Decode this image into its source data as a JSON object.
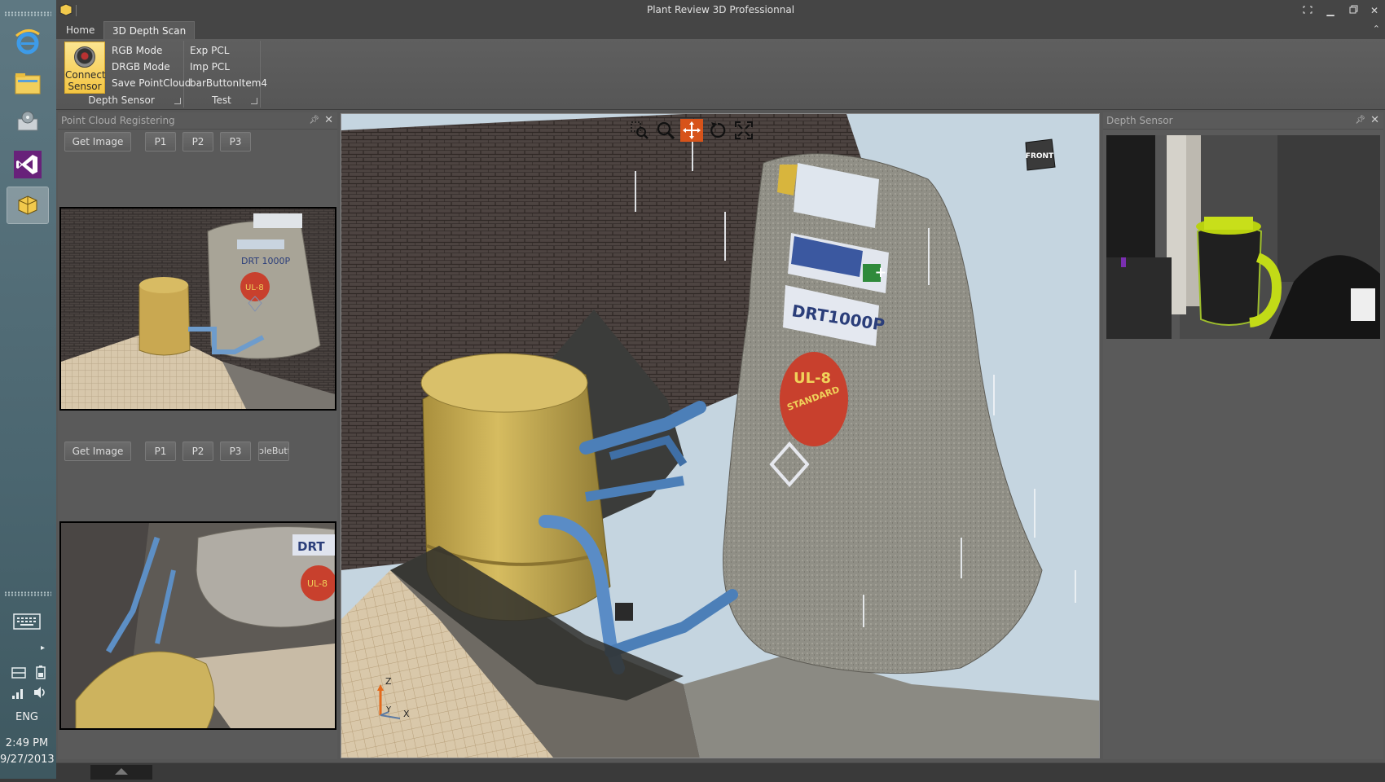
{
  "taskbar": {
    "language": "ENG",
    "time": "2:49 PM",
    "date": "9/27/2013",
    "icons": [
      "internet-explorer-icon",
      "file-explorer-icon",
      "disk-icon",
      "visual-studio-icon",
      "plant-review-icon"
    ]
  },
  "window": {
    "title": "Plant Review 3D Professionnal"
  },
  "ribbon": {
    "tabs": [
      "Home",
      "3D Depth Scan"
    ],
    "selected_tab": "3D Depth Scan",
    "groups": [
      {
        "label": "Depth Sensor",
        "large_button": {
          "line1": "Connect",
          "line2": "Sensor"
        },
        "buttons": [
          "RGB Mode",
          "DRGB Mode",
          "Save PointCloud"
        ]
      },
      {
        "label": "Test",
        "buttons": [
          "Exp PCL",
          "Imp PCL",
          "barButtonItem4"
        ]
      }
    ]
  },
  "left_panel": {
    "title": "Point Cloud Registering",
    "row1": {
      "get_image": "Get Image",
      "p1": "P1",
      "p2": "P2",
      "p3": "P3"
    },
    "row2": {
      "get_image": "Get Image",
      "p1": "P1",
      "p2": "P2",
      "p3": "P3",
      "extra": "ɔleButt"
    }
  },
  "viewer": {
    "toolbar": [
      "zoom-window-icon",
      "zoom-icon",
      "pan-icon",
      "rotate-icon",
      "fit-screen-icon"
    ],
    "selected_tool": "pan-icon",
    "view_cube_label": "FRONT",
    "axes": {
      "z": "Z",
      "y": "Y",
      "x": "X"
    },
    "tank_labels": {
      "model": "DRT1000P",
      "badge": "UL-8",
      "badge_sub": "STANDARD"
    }
  },
  "right_panel": {
    "title": "Depth Sensor"
  },
  "thumb_labels": {
    "top_model": "DRT 1000P",
    "top_badge": "UL-8",
    "bottom_brand": "DRT",
    "bottom_badge": "UL-8"
  },
  "colors": {
    "accent_orange": "#d7531a",
    "ribbon_highlight": "#f4c542",
    "panel_bg": "#5a5a5a",
    "tank_yellow": "#bda24a",
    "tank_grey": "#8d8c82",
    "pipe_blue": "#4c7fb8"
  }
}
